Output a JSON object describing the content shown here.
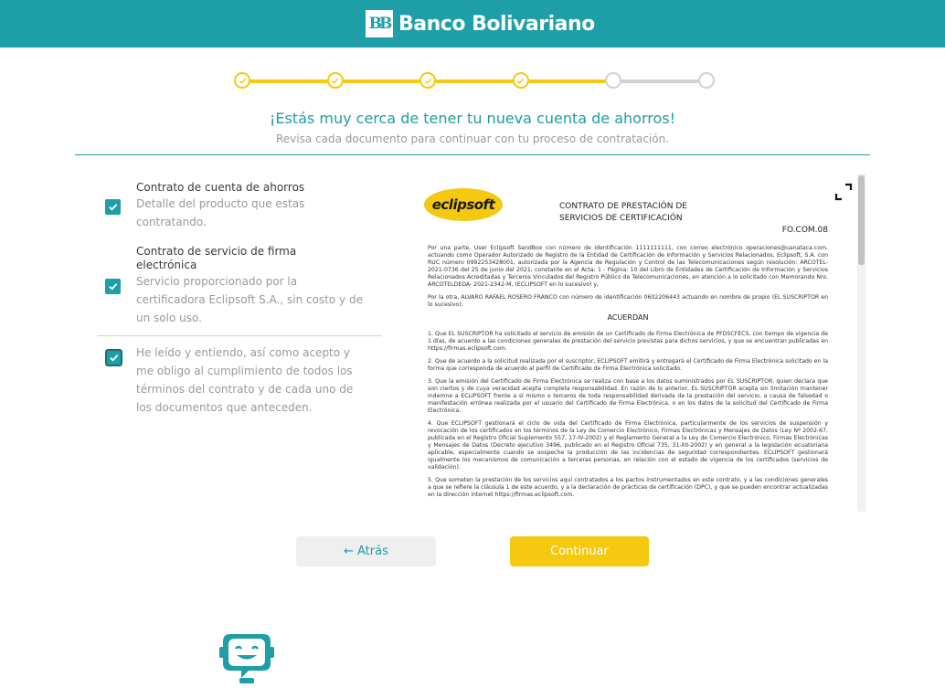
{
  "header": {
    "brand": "Banco Bolivariano",
    "brand_mark": "BB",
    "bg_color": "#1e9ea6"
  },
  "stepper": {
    "total": 6,
    "completed": 4,
    "active_color": "#f4c90f",
    "pending_color": "#d0d0d0"
  },
  "intro": {
    "title": "¡Estás muy cerca de tener tu nueva cuenta de ahorros!",
    "subtitle": "Revisa cada documento para continuar con tu proceso de contratación."
  },
  "documents": [
    {
      "title": "Contrato de cuenta de ahorros",
      "description": "Detalle del producto que estas contratando.",
      "checked": true
    },
    {
      "title": "Contrato de servicio de firma electrónica",
      "description": "Servicio proporcionado por la certificadora Eclipsoft S.A., sin costo y de un solo uso.",
      "checked": true
    }
  ],
  "acceptance": {
    "text": "He leído y entiendo, así como acepto y me obligo al cumplimiento de todos los términos del contrato y de cada uno de los documentos que anteceden.",
    "checked": true
  },
  "viewer": {
    "logo_text": "eclipsoft",
    "heading": "CONTRATO DE PRESTACIÓN DE SERVICIOS DE CERTIFICACIÓN",
    "code": "FO.COM.08",
    "paragraphs": [
      "Por una parte, User Eclipsoft SandBox con número de identificación 1111111111, con correo electrónico operaciones@uanataca.com, actuando como Operador Autorizado de Registro de la Entidad de Certificación de Información y Servicios Relacionados, Eclipsoft, S.A. con RUC número 0992253428001, autorizada por la Agencia de Regulación y Control de las Telecomunicaciones según resolución: ARCOTEL-2021-0736 del 25 de junio del 2021, constante en el Acta: 1 - Página: 10 del Libro de Entidades de Certificación de Información y Servicios Relacionados Acreditadas y Terceros Vinculados del Registro Público de Telecomunicaciones, en atención a lo solicitado con Memorando Nro. ARCOTELDEDA- 2021-2342-M, (ECLIPSOFT en lo sucesivo) y,",
      "Por la otra, ALVARO RAFAEL ROSERO FRANCO con número de identificación 0602206443 actuando en nombre de propio (EL SUSCRIPTOR en lo sucesivo);"
    ],
    "section_title": "ACUERDAN",
    "clauses": [
      "1. Que EL SUSCRIPTOR ha solicitado el servicio de emisión de un Certificado de Firma Electrónica de PFDSCFECS, con tiempo de vigencia de 1 días, de acuerdo a las condiciones generales de prestación del servicio previstas para dichos servicios, y que se encuentran publicadas en https://firmas.eclipsoft.com.",
      "2. Que de acuerdo a la solicitud realizada por el suscriptor, ECLIPSOFT emitirá y entregará el Certificado de Firma Electrónica solicitado en la forma que corresponda de acuerdo al perfil de Certificado de Firma Electrónica solicitado.",
      "3. Que la emisión del Certificado de Firma Electrónica se realiza con base a los datos suministrados por EL SUSCRIPTOR, quien declara que son ciertos y de cuya veracidad acepta completa responsabilidad. En razón de lo anterior, EL SUSCRIPTOR acepta sin limitación mantener indemne a ECLIPSOFT frente a sí mismo o terceros de toda responsabilidad derivada de la prestación del servicio, a causa de falsedad o manifestación errónea realizada por el usuario del Certificado de Firma Electrónica, o en los datos de la solicitud del Certificado de Firma Electrónica.",
      "4. Que ECLIPSOFT gestionará el ciclo de vida del Certificado de Firma Electrónica, particularmente de los servicios de suspensión y revocación de los certificados en los términos de la Ley de Comercio Electrónico, Firmas Electrónicas y Mensajes de Datos (Ley Nº 2002-67, publicada en el Registro Oficial Suplemento 557, 17-IV-2002) y el Reglamento General a la Ley de Comercio Electrónico, Firmas Electrónicas y Mensajes de Datos (Decreto ejecutivo 3496, publicado en el Registro Oficial 735, 31-XII-2002) y en general a la legislación ecuatoriana aplicable, especialmente cuando se sospeche la producción de las incidencias de seguridad correspondientes. ECLIPSOFT gestionará igualmente los mecanismos de comunicación a terceras personas, en relación con el estado de vigencia de los certificados (servicios de validación).",
      "5. Que someten la prestación de los servicios aquí contratados a los pactos instrumentados en este contrato, y a las condiciones generales a que se refiere la cláusula 1 de este acuerdo, y a la declaración de prácticas de certificación (DPC), y que se pueden encontrar actualizadas en la dirección internet https://firmas.eclipsoft.com."
    ]
  },
  "buttons": {
    "back_label": "Atrás",
    "back_icon": "←",
    "continue_label": "Continuar"
  },
  "icons": {
    "expand": "expand-icon",
    "check": "check-icon",
    "assistant": "chatbot-icon"
  }
}
